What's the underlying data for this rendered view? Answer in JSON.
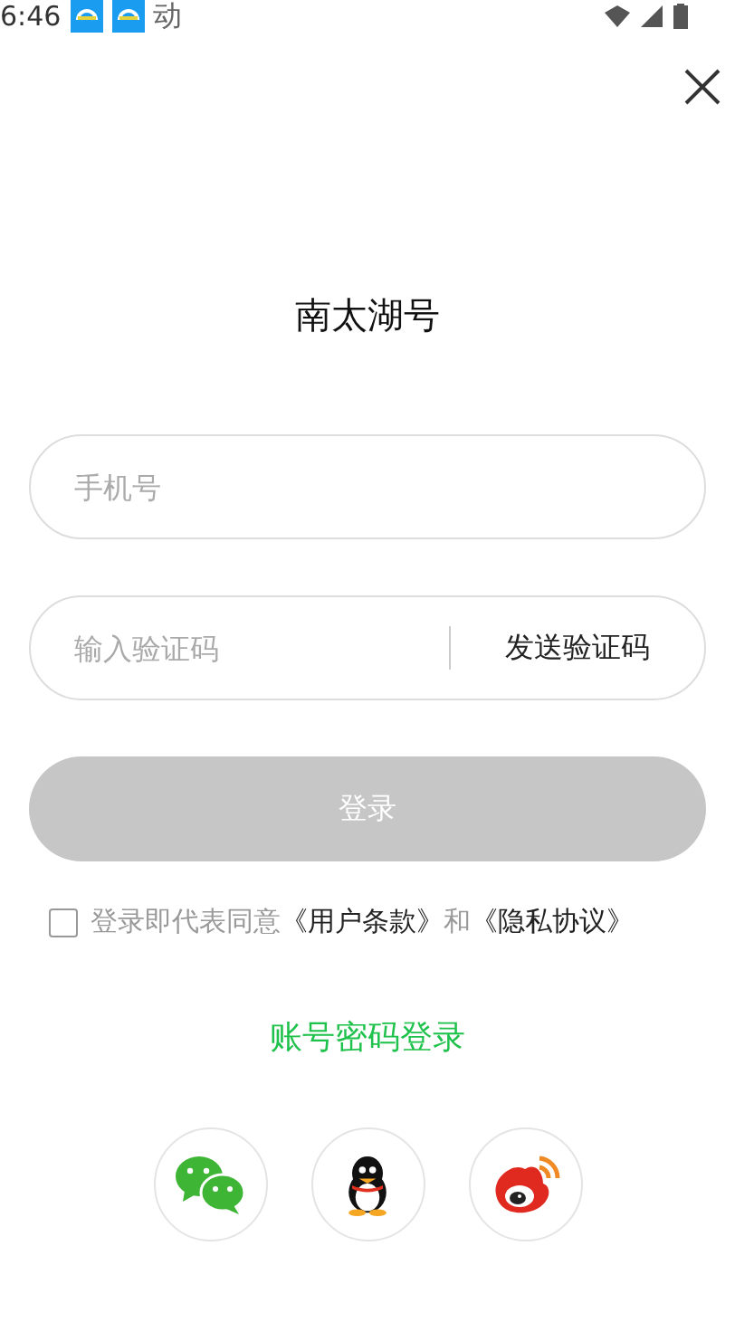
{
  "status_bar": {
    "time": "6:46",
    "notification_glyph": "动"
  },
  "title": "南太湖号",
  "phone_field": {
    "placeholder": "手机号"
  },
  "code_field": {
    "placeholder": "输入验证码",
    "send_button": "发送验证码"
  },
  "login_button": {
    "label": "登录",
    "disabled": true
  },
  "agreement": {
    "checked": false,
    "text_before": "登录即代表同意",
    "terms_link": "《用户条款》",
    "joiner": "和",
    "privacy_link": "《隐私协议》"
  },
  "password_login_link": "账号密码登录",
  "social_logins": [
    {
      "kind": "wechat"
    },
    {
      "kind": "qq"
    },
    {
      "kind": "weibo"
    }
  ]
}
